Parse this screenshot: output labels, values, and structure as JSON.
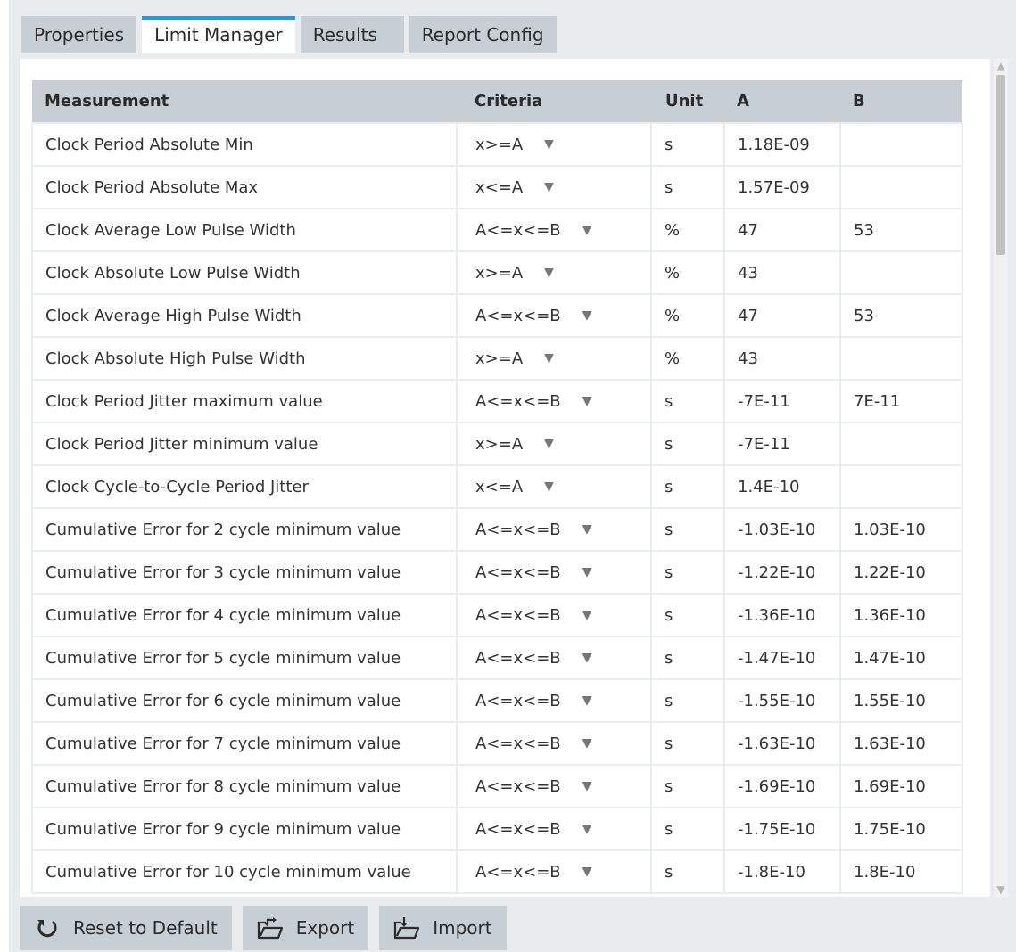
{
  "tabs": [
    {
      "label": "Properties"
    },
    {
      "label": "Limit Manager"
    },
    {
      "label": "Results"
    },
    {
      "label": "Report Config"
    }
  ],
  "table": {
    "headers": {
      "measurement": "Measurement",
      "criteria": "Criteria",
      "unit": "Unit",
      "a": "A",
      "b": "B"
    },
    "rows": [
      {
        "measurement": "Clock Period Absolute Min",
        "criteria": "x>=A",
        "unit": "s",
        "a": "1.18E-09",
        "b": ""
      },
      {
        "measurement": "Clock Period Absolute Max",
        "criteria": "x<=A",
        "unit": "s",
        "a": "1.57E-09",
        "b": ""
      },
      {
        "measurement": "Clock Average Low Pulse Width",
        "criteria": "A<=x<=B",
        "unit": "%",
        "a": "47",
        "b": "53"
      },
      {
        "measurement": "Clock Absolute Low Pulse Width",
        "criteria": "x>=A",
        "unit": "%",
        "a": "43",
        "b": ""
      },
      {
        "measurement": "Clock Average High Pulse Width",
        "criteria": "A<=x<=B",
        "unit": "%",
        "a": "47",
        "b": "53"
      },
      {
        "measurement": "Clock Absolute High Pulse Width",
        "criteria": "x>=A",
        "unit": "%",
        "a": "43",
        "b": ""
      },
      {
        "measurement": "Clock Period Jitter maximum value",
        "criteria": "A<=x<=B",
        "unit": "s",
        "a": "-7E-11",
        "b": "7E-11"
      },
      {
        "measurement": "Clock Period Jitter minimum value",
        "criteria": "x>=A",
        "unit": "s",
        "a": "-7E-11",
        "b": ""
      },
      {
        "measurement": "Clock Cycle-to-Cycle Period Jitter",
        "criteria": "x<=A",
        "unit": "s",
        "a": "1.4E-10",
        "b": ""
      },
      {
        "measurement": "Cumulative Error for 2 cycle minimum value",
        "criteria": "A<=x<=B",
        "unit": "s",
        "a": "-1.03E-10",
        "b": "1.03E-10"
      },
      {
        "measurement": "Cumulative Error for 3 cycle minimum value",
        "criteria": "A<=x<=B",
        "unit": "s",
        "a": "-1.22E-10",
        "b": "1.22E-10"
      },
      {
        "measurement": "Cumulative Error for 4 cycle minimum value",
        "criteria": "A<=x<=B",
        "unit": "s",
        "a": "-1.36E-10",
        "b": "1.36E-10"
      },
      {
        "measurement": "Cumulative Error for 5 cycle minimum value",
        "criteria": "A<=x<=B",
        "unit": "s",
        "a": "-1.47E-10",
        "b": "1.47E-10"
      },
      {
        "measurement": "Cumulative Error for 6 cycle minimum value",
        "criteria": "A<=x<=B",
        "unit": "s",
        "a": "-1.55E-10",
        "b": "1.55E-10"
      },
      {
        "measurement": "Cumulative Error for 7 cycle minimum value",
        "criteria": "A<=x<=B",
        "unit": "s",
        "a": "-1.63E-10",
        "b": "1.63E-10"
      },
      {
        "measurement": "Cumulative Error for 8 cycle minimum value",
        "criteria": "A<=x<=B",
        "unit": "s",
        "a": "-1.69E-10",
        "b": "1.69E-10"
      },
      {
        "measurement": "Cumulative Error for 9 cycle minimum value",
        "criteria": "A<=x<=B",
        "unit": "s",
        "a": "-1.75E-10",
        "b": "1.75E-10"
      },
      {
        "measurement": "Cumulative Error for 10 cycle minimum value",
        "criteria": "A<=x<=B",
        "unit": "s",
        "a": "-1.8E-10",
        "b": "1.8E-10"
      }
    ]
  },
  "footer": {
    "reset_label": "Reset to Default",
    "export_label": "Export",
    "import_label": "Import"
  },
  "icons": {
    "reset": "reset-icon",
    "export": "export-icon",
    "import": "import-icon",
    "dropdown": "chevron-down-icon"
  },
  "colors": {
    "accent": "#1e9be6",
    "header_bg": "#c7ced4",
    "background": "#e9ecef"
  }
}
